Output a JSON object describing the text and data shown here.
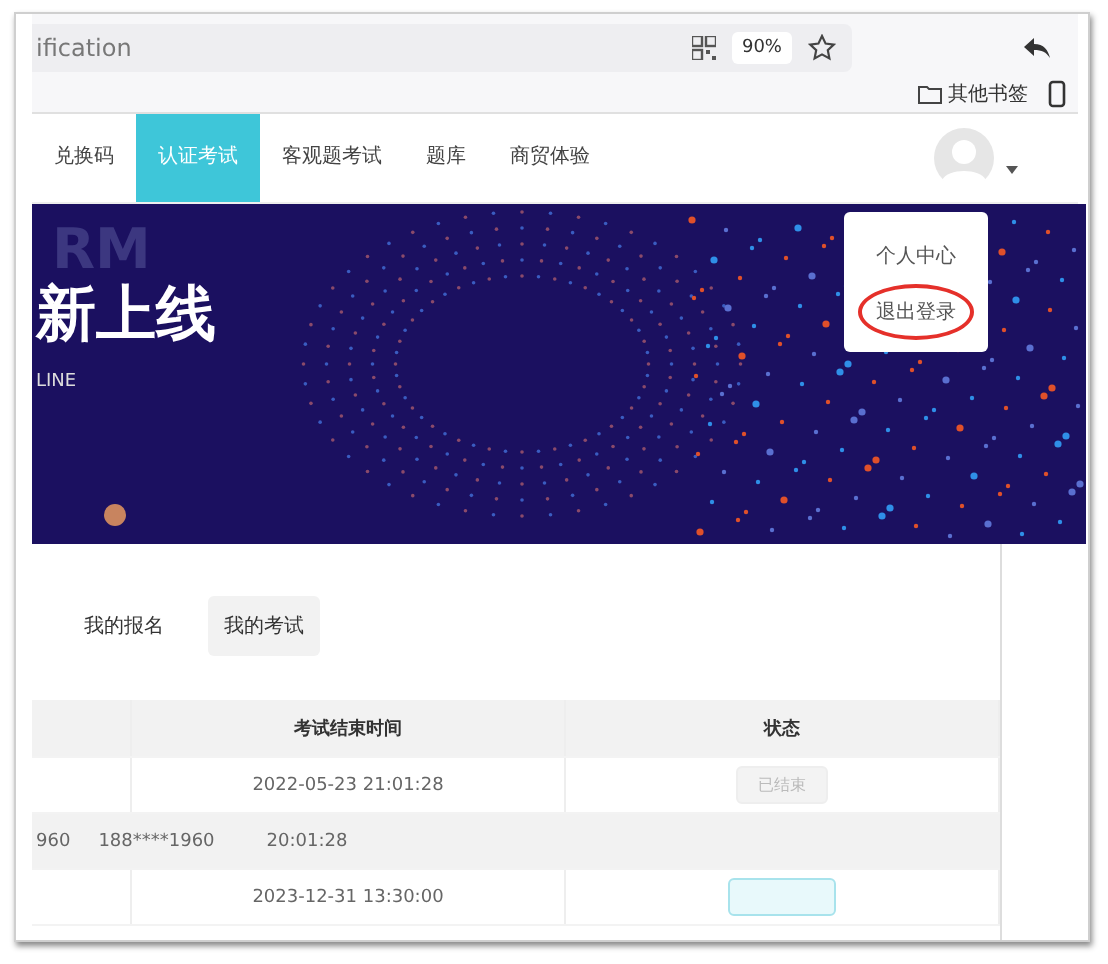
{
  "browser": {
    "address": "ification",
    "zoom": "90%",
    "bookmark_folder": "其他书签"
  },
  "nav": {
    "tabs": [
      {
        "label": "兑换码",
        "selected": false
      },
      {
        "label": "认证考试",
        "selected": true
      },
      {
        "label": "客观题考试",
        "selected": false
      },
      {
        "label": "题库",
        "selected": false
      },
      {
        "label": "商贸体验",
        "selected": false
      }
    ]
  },
  "user_menu": {
    "items": [
      {
        "label": "个人中心",
        "circled": false
      },
      {
        "label": "退出登录",
        "circled": true
      }
    ]
  },
  "banner": {
    "watermark": "RM",
    "headline": "新上线",
    "subtitle": "LINE"
  },
  "page_tabs": [
    {
      "label": "我的报名",
      "selected": false
    },
    {
      "label": "我的考试",
      "selected": true
    }
  ],
  "table": {
    "columns": [
      {
        "label": "考试结束时间"
      },
      {
        "label": "状态"
      }
    ],
    "rows": [
      {
        "kind": "normal",
        "hovered": false,
        "end_time": "2022-05-23 21:01:28",
        "status": {
          "kind": "ended",
          "label": "已结束"
        }
      },
      {
        "kind": "overlay",
        "hovered": true,
        "cells": [
          "960",
          "188****1960",
          "20:01:28"
        ]
      },
      {
        "kind": "normal",
        "hovered": false,
        "end_time": "2023-12-31 13:30:00",
        "status": {
          "kind": "action"
        }
      }
    ]
  }
}
